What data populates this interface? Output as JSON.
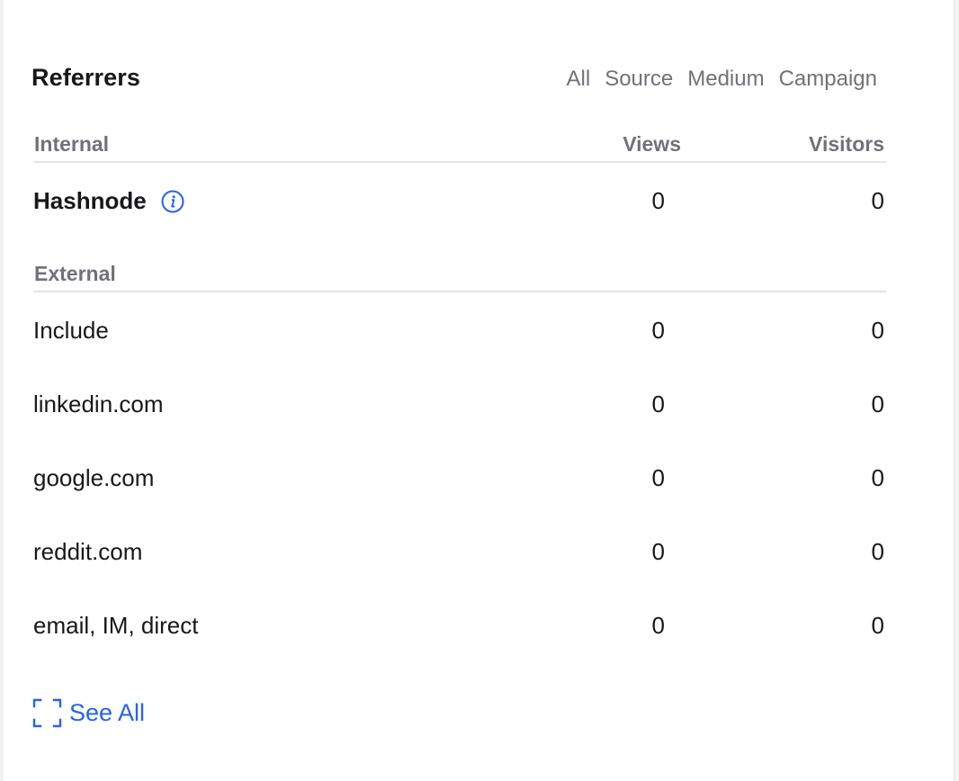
{
  "referrers": {
    "title": "Referrers",
    "filters": [
      "All",
      "Source",
      "Medium",
      "Campaign"
    ],
    "columns": {
      "views": "Views",
      "visitors": "Visitors"
    },
    "internal": {
      "label": "Internal",
      "rows": [
        {
          "name": "Hashnode",
          "views": "0",
          "visitors": "0",
          "icon": "info-icon"
        }
      ]
    },
    "external": {
      "label": "External",
      "rows": [
        {
          "name": "Include",
          "views": "0",
          "visitors": "0"
        },
        {
          "name": "linkedin.com",
          "views": "0",
          "visitors": "0"
        },
        {
          "name": "google.com",
          "views": "0",
          "visitors": "0"
        },
        {
          "name": "reddit.com",
          "views": "0",
          "visitors": "0"
        },
        {
          "name": "email, IM, direct",
          "views": "0",
          "visitors": "0"
        }
      ]
    },
    "see_all": {
      "label": "See All",
      "icon": "expand-icon"
    },
    "colors": {
      "accent": "#2563eb",
      "muted": "#71717a",
      "text": "#18181b"
    }
  }
}
